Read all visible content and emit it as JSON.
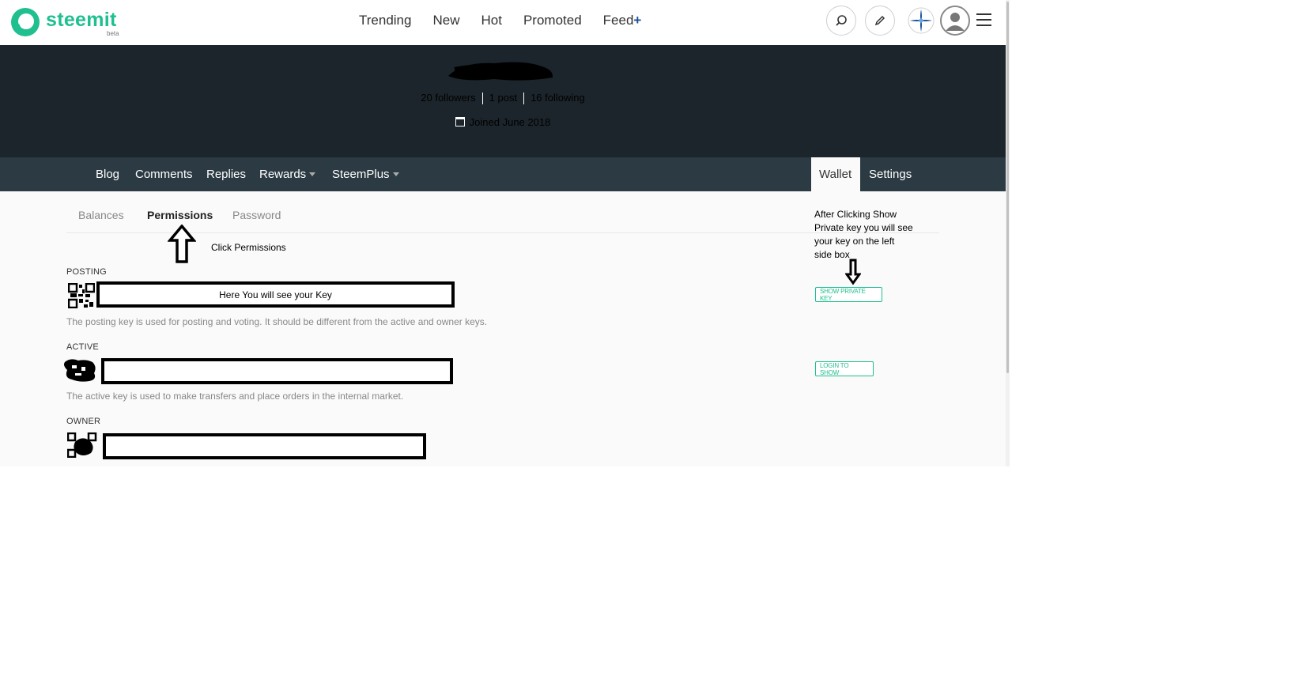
{
  "header": {
    "logo_text": "steemit",
    "logo_badge": "beta",
    "nav": [
      "Trending",
      "New",
      "Hot",
      "Promoted"
    ],
    "feed_label": "Feed",
    "feed_plus": "+",
    "search_icon": "search-icon",
    "compose_icon": "pencil-icon",
    "menu_icon": "hamburger-icon"
  },
  "profile": {
    "followers": "20 followers",
    "posts": "1 post",
    "following": "16 following",
    "joined": "Joined June 2018"
  },
  "tabs": {
    "blog": "Blog",
    "comments": "Comments",
    "replies": "Replies",
    "rewards": "Rewards",
    "steemplus": "SteemPlus",
    "wallet": "Wallet",
    "settings": "Settings"
  },
  "wallet_tabs": {
    "balances": "Balances",
    "permissions": "Permissions",
    "password": "Password"
  },
  "annotations": {
    "click_permissions": "Click Permissions",
    "right_note": "After Clicking Show Private key you will see your key on the left side box"
  },
  "keys": {
    "posting": {
      "label": "POSTING",
      "box_text": "Here You will see your Key",
      "description": "The posting key is used for posting and voting. It should be different from the active and owner keys.",
      "button": "SHOW PRIVATE KEY"
    },
    "active": {
      "label": "ACTIVE",
      "description": "The active key is used to make transfers and place orders in the internal market.",
      "button": "LOGIN TO SHOW"
    },
    "owner": {
      "label": "OWNER"
    }
  },
  "colors": {
    "brand": "#1fbf8f",
    "banner": "#1c252b",
    "tabbar": "#2c3a43"
  }
}
